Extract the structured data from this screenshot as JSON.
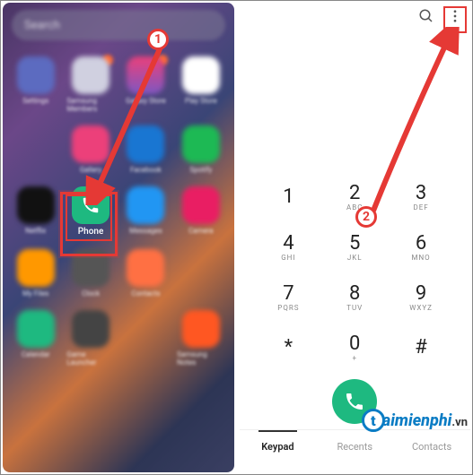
{
  "annotations": {
    "step1": "1",
    "step2": "2"
  },
  "homescreen": {
    "search_placeholder": "Search",
    "apps": {
      "settings": "Settings",
      "samsung_members": "Samsung Members",
      "galaxy_store": "Galaxy Store",
      "play_store": "Play Store",
      "gallery": "Gallery",
      "facebook": "Facebook",
      "spotify": "Spotify",
      "netflix": "Netflix",
      "phone": "Phone",
      "messages": "Messages",
      "camera": "Camera",
      "my_files": "My Files",
      "clock": "Clock",
      "contacts": "Contacts",
      "calendar": "Calendar",
      "game_launcher": "Game Launcher",
      "samsung_notes": "Samsung Notes"
    }
  },
  "dialer": {
    "keys": {
      "k1": {
        "d": "1",
        "l": ""
      },
      "k2": {
        "d": "2",
        "l": "ABC"
      },
      "k3": {
        "d": "3",
        "l": "DEF"
      },
      "k4": {
        "d": "4",
        "l": "GHI"
      },
      "k5": {
        "d": "5",
        "l": "JKL"
      },
      "k6": {
        "d": "6",
        "l": "MNO"
      },
      "k7": {
        "d": "7",
        "l": "PQRS"
      },
      "k8": {
        "d": "8",
        "l": "TUV"
      },
      "k9": {
        "d": "9",
        "l": "WXYZ"
      },
      "kstar": {
        "d": "*",
        "l": ""
      },
      "k0": {
        "d": "0",
        "l": "+"
      },
      "khash": {
        "d": "#",
        "l": ""
      }
    },
    "tabs": {
      "keypad": "Keypad",
      "recents": "Recents",
      "contacts": "Contacts"
    }
  },
  "watermark": {
    "initial": "t",
    "text": "aimienphi",
    "suffix": ".vn"
  }
}
